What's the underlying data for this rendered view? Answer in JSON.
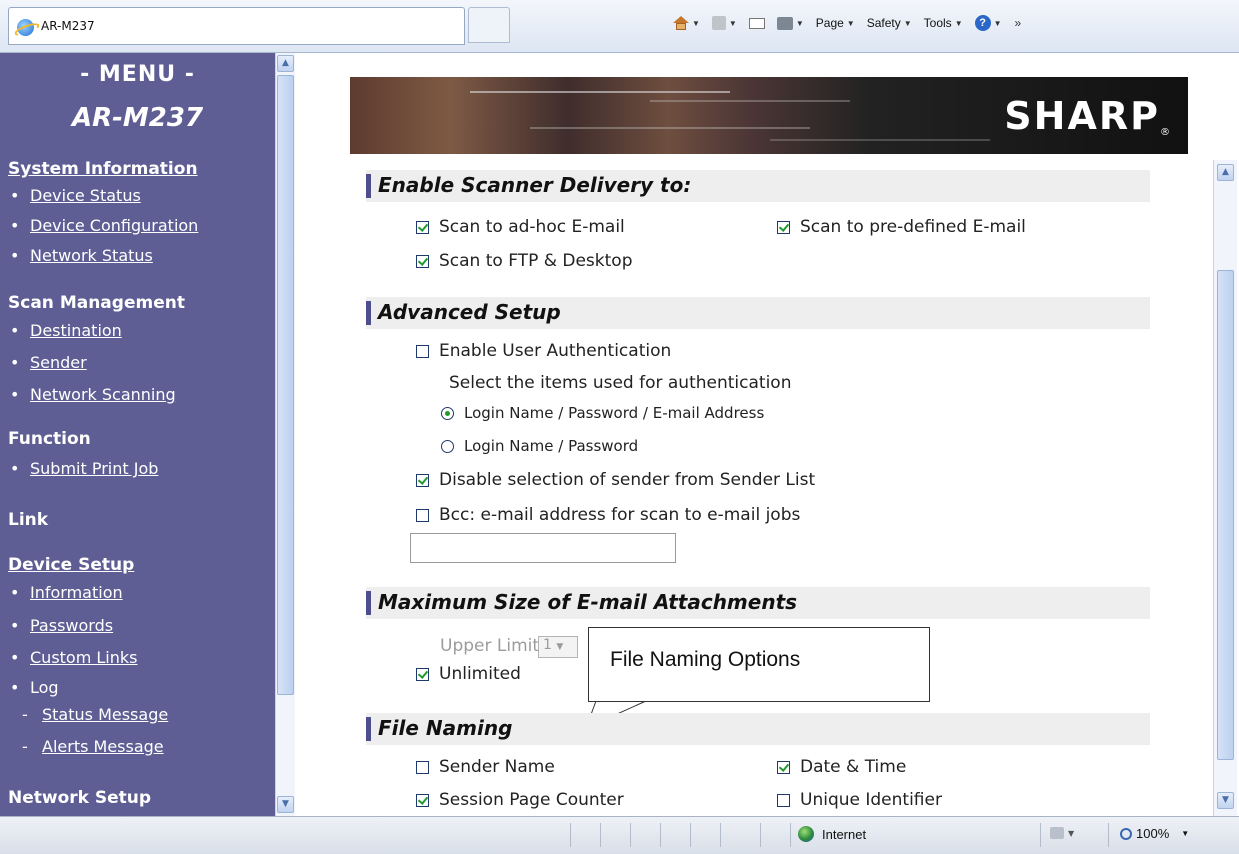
{
  "browser": {
    "tab_title": "AR-M237",
    "commands": {
      "page": "Page",
      "safety": "Safety",
      "tools": "Tools"
    },
    "overflow": "»"
  },
  "sidebar": {
    "menu_title": "- MENU -",
    "model": "AR-M237",
    "sections": {
      "system_information": "System Information",
      "scan_management": "Scan Management",
      "function": "Function",
      "link": "Link",
      "device_setup": "Device Setup",
      "network_setup": "Network Setup"
    },
    "items": {
      "device_status": "Device Status",
      "device_configuration": "Device Configuration",
      "network_status": "Network Status",
      "destination": "Destination",
      "sender": "Sender",
      "network_scanning": "Network Scanning",
      "submit_print_job": "Submit Print Job",
      "information": "Information",
      "passwords": "Passwords",
      "custom_links": "Custom Links",
      "log": "Log",
      "status_message": "Status Message",
      "alerts_message": "Alerts Message"
    }
  },
  "banner": {
    "brand": "SHARP",
    "reg": "®"
  },
  "scanner_delivery": {
    "heading": "Enable Scanner Delivery to:",
    "adhoc_email": {
      "label": "Scan to ad-hoc E-mail",
      "checked": true
    },
    "predefined_email": {
      "label": "Scan to pre-defined E-mail",
      "checked": true
    },
    "ftp_desktop": {
      "label": "Scan to FTP & Desktop",
      "checked": true
    }
  },
  "advanced_setup": {
    "heading": "Advanced Setup",
    "user_auth": {
      "label": "Enable User Authentication",
      "checked": false
    },
    "auth_items_label": "Select the items used for authentication",
    "auth_option_1": {
      "label": "Login Name / Password / E-mail Address",
      "selected": true
    },
    "auth_option_2": {
      "label": "Login Name / Password",
      "selected": false
    },
    "disable_sender": {
      "label": "Disable selection of sender from Sender List",
      "checked": true
    },
    "bcc": {
      "label": "Bcc: e-mail address for scan to e-mail jobs",
      "checked": false
    },
    "bcc_value": ""
  },
  "max_attachments": {
    "heading": "Maximum Size of E-mail Attachments",
    "upper_limit_label": "Upper Limit",
    "upper_limit_value": "1",
    "unlimited": {
      "label": "Unlimited",
      "checked": true
    }
  },
  "callout": {
    "text": "File Naming Options"
  },
  "file_naming": {
    "heading": "File Naming",
    "sender_name": {
      "label": "Sender Name",
      "checked": false
    },
    "date_time": {
      "label": "Date & Time",
      "checked": true
    },
    "session_page_counter": {
      "label": "Session Page Counter",
      "checked": true
    },
    "unique_identifier": {
      "label": "Unique Identifier",
      "checked": false
    }
  },
  "statusbar": {
    "zone": "Internet",
    "zoom": "100%"
  }
}
